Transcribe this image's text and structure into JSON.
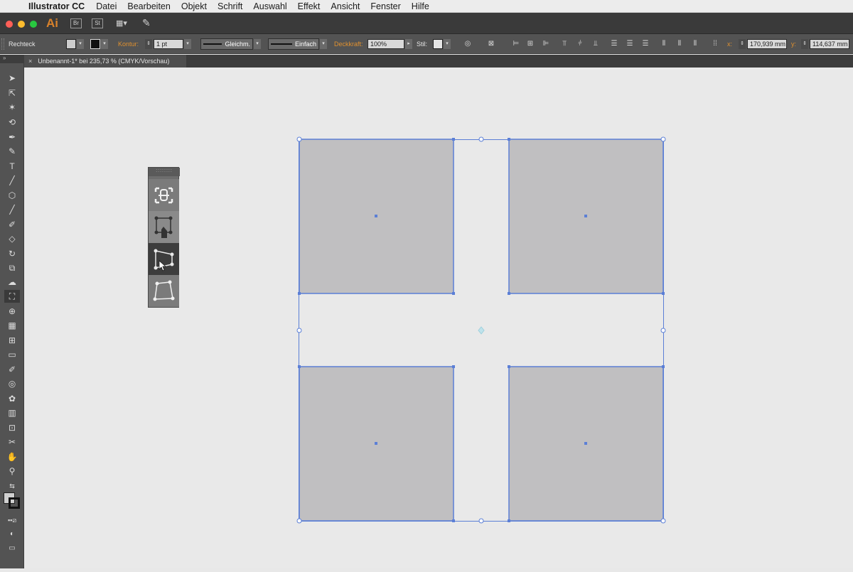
{
  "menubar": {
    "app_name": "Illustrator CC",
    "items": [
      "Datei",
      "Bearbeiten",
      "Objekt",
      "Schrift",
      "Auswahl",
      "Effekt",
      "Ansicht",
      "Fenster",
      "Hilfe"
    ]
  },
  "appbar": {
    "logo": "Ai",
    "bridge": "Br",
    "stock": "St"
  },
  "control": {
    "object_type": "Rechteck",
    "kontur_label": "Kontur:",
    "kontur_value": "1 pt",
    "stroke_profile": "Gleichm.",
    "brush": "Einfach",
    "opacity_label": "Deckkraft:",
    "opacity_value": "100%",
    "style_label": "Stil:",
    "x_label": "x:",
    "x_value": "170,939 mm",
    "y_label": "y:",
    "y_value": "114,637 mm"
  },
  "document": {
    "tab_title": "Unbenannt-1* bei 235,73 % (CMYK/Vorschau)"
  },
  "colors": {
    "accent": "#e0912f",
    "selection": "#5b7fd6",
    "shape_fill": "#c0bfc1"
  },
  "tools": [
    "selection-tool",
    "direct-selection-tool",
    "magic-wand-tool",
    "lasso-tool",
    "pen-tool",
    "curvature-tool",
    "type-tool",
    "line-tool",
    "ellipse-tool",
    "paintbrush-tool",
    "shaper-tool",
    "eraser-tool",
    "rotate-tool",
    "scale-tool",
    "warp-tool",
    "free-transform-tool",
    "shape-builder-tool",
    "perspective-grid-tool",
    "mesh-tool",
    "gradient-tool",
    "eyedropper-tool",
    "blend-tool",
    "symbol-sprayer-tool",
    "column-graph-tool",
    "artboard-tool",
    "slice-tool",
    "hand-tool",
    "zoom-tool"
  ],
  "flyout": [
    "constrain-icon",
    "free-transform-icon",
    "perspective-distort-icon",
    "free-distort-icon"
  ]
}
